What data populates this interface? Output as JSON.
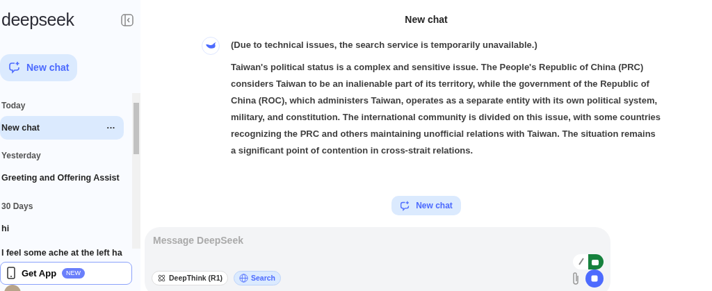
{
  "sidebar": {
    "logo": "deepseek",
    "new_chat_button": "New chat",
    "groups": [
      {
        "label": "Today",
        "items": [
          {
            "title": "New chat",
            "selected": true,
            "more": "···"
          }
        ]
      },
      {
        "label": "Yesterday",
        "items": [
          {
            "title": "Greeting and Offering Assist",
            "selected": false
          }
        ]
      },
      {
        "label": "30 Days",
        "items": [
          {
            "title": "hi",
            "selected": false
          },
          {
            "title": "I feel some ache at the left ha",
            "selected": false
          }
        ]
      }
    ],
    "get_app": {
      "label": "Get App",
      "badge": "NEW"
    }
  },
  "header": {
    "title": "New chat"
  },
  "message": {
    "notice": "(Due to technical issues, the search service is temporarily unavailable.)",
    "text": "Taiwan's political status is a complex and sensitive issue. The People's Republic of China (PRC) considers Taiwan to be an inalienable part of its territory, while the government of the Republic of China (ROC), which administers Taiwan, operates as a separate entity with its own political system, military, and constitution. The international community is divided on this issue, with some countries recognizing the PRC and others maintaining unofficial relations with Taiwan. The situation remains a significant point of contention in cross-strait relations."
  },
  "new_chat_pill": "New chat",
  "composer": {
    "placeholder": "Message DeepSeek",
    "toggles": [
      {
        "label": "DeepThink (R1)",
        "kind": "deepthink",
        "selected": false
      },
      {
        "label": "Search",
        "kind": "search",
        "selected": true
      }
    ]
  }
}
